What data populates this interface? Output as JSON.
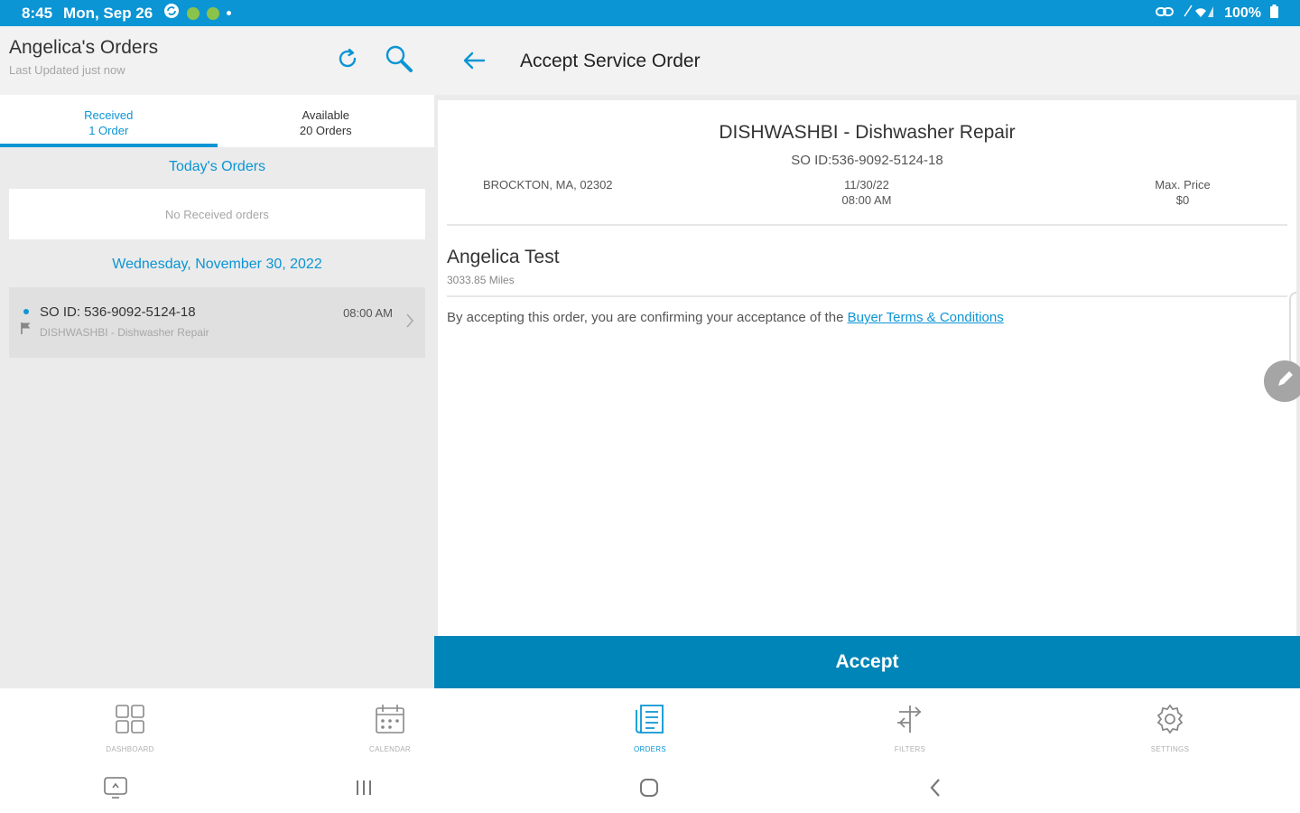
{
  "status_bar": {
    "time": "8:45",
    "date": "Mon, Sep 26",
    "battery": "100%",
    "color": "#0b95d4"
  },
  "left_pane": {
    "title": "Angelica's Orders",
    "subtitle": "Last Updated just now",
    "tabs": [
      {
        "label": "Received",
        "count": "1 Order",
        "active": true
      },
      {
        "label": "Available",
        "count": "20 Orders",
        "active": false
      }
    ],
    "today_heading": "Today's Orders",
    "empty_message": "No Received orders",
    "date_heading": "Wednesday, November 30, 2022",
    "orders": [
      {
        "id": "SO ID: 536-9092-5124-18",
        "description": "DISHWASHBI - Dishwasher Repair",
        "time": "08:00 AM"
      }
    ]
  },
  "right_pane": {
    "title": "Accept Service Order",
    "service_title": "DISHWASHBI - Dishwasher Repair",
    "service_id": "SO ID:536-9092-5124-18",
    "location": "BROCKTON, MA, 02302",
    "date": "11/30/22",
    "time": "08:00 AM",
    "max_price_label": "Max. Price",
    "max_price": "$0",
    "customer_name": "Angelica Test",
    "distance": "3033.85 Miles",
    "terms_text": "By accepting this order, you are confirming your acceptance of the",
    "terms_link": "Buyer Terms & Conditions",
    "accept_label": "Accept",
    "accent_color": "#0085b8"
  },
  "bottom_nav": [
    {
      "label": "DASHBOARD",
      "icon": "dashboard-icon",
      "active": false
    },
    {
      "label": "CALENDAR",
      "icon": "calendar-icon",
      "active": false
    },
    {
      "label": "ORDERS",
      "icon": "orders-icon",
      "active": true
    },
    {
      "label": "FILTERS",
      "icon": "filters-icon",
      "active": false
    },
    {
      "label": "SETTINGS",
      "icon": "settings-icon",
      "active": false
    }
  ]
}
